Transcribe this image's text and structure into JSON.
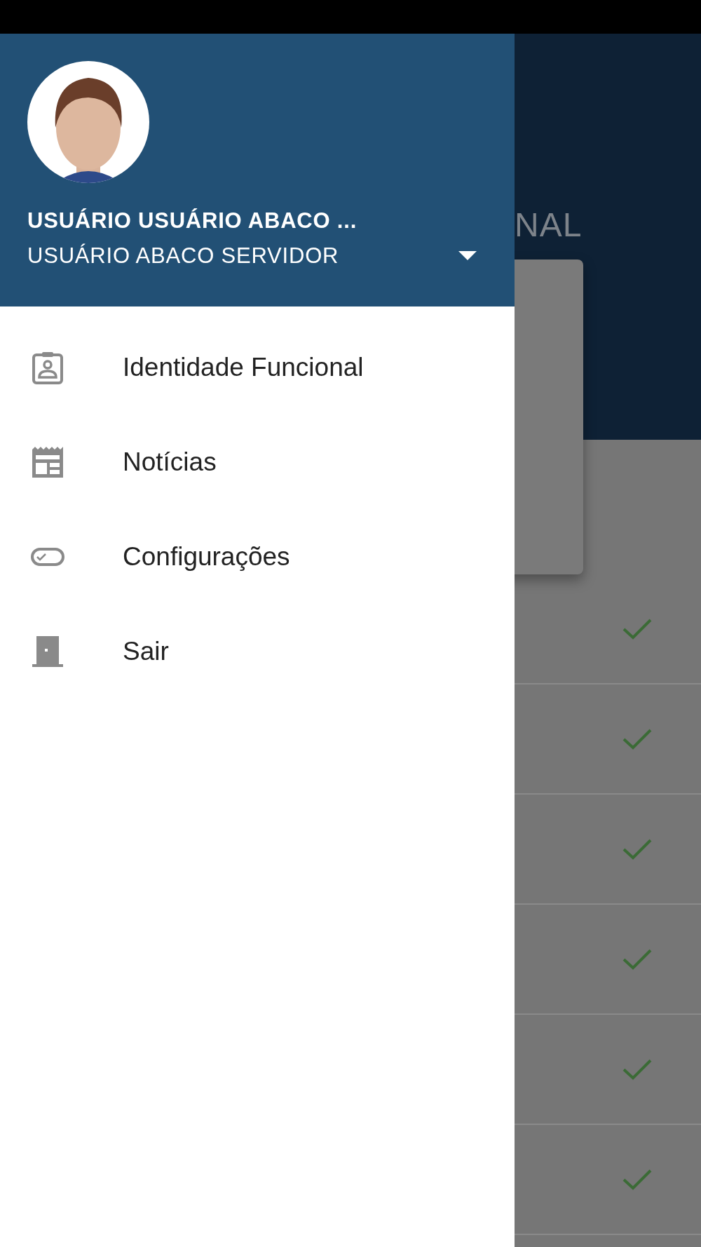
{
  "background": {
    "title_fragment": "NAL",
    "rows": [
      {
        "checked": true
      },
      {
        "checked": true
      },
      {
        "checked": true
      },
      {
        "checked": true
      },
      {
        "checked": true
      },
      {
        "checked": true
      }
    ]
  },
  "drawer": {
    "user": {
      "name": "USUÁRIO USUÁRIO ABACO ...",
      "role": "USUÁRIO ABACO SERVIDOR",
      "expanded": false
    },
    "menu": [
      {
        "label": "Identidade Funcional",
        "kind": "badge"
      },
      {
        "label": "Notícias",
        "kind": "news"
      },
      {
        "label": "Configurações",
        "kind": "toggle"
      },
      {
        "label": "Sair",
        "kind": "door"
      }
    ]
  }
}
